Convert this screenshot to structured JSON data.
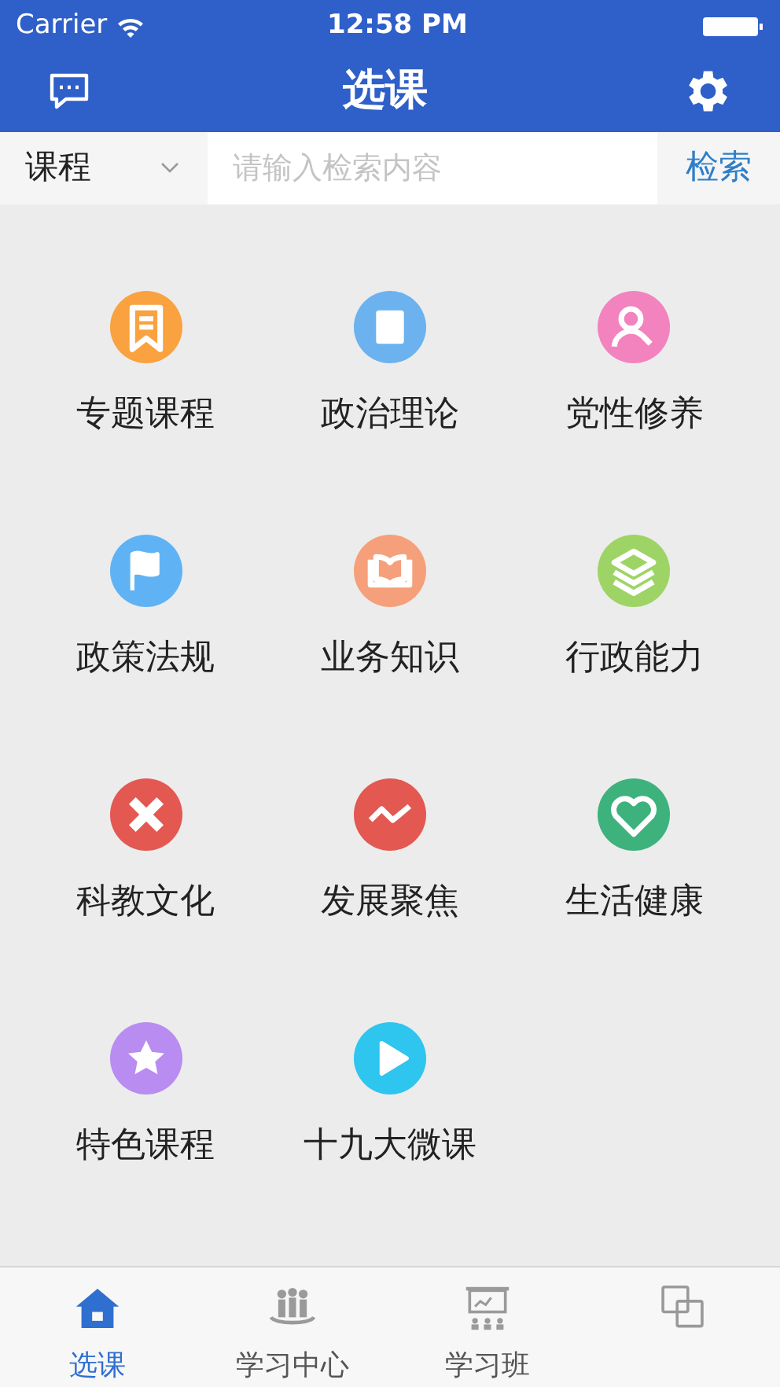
{
  "status_bar": {
    "carrier": "Carrier",
    "time": "12:58 PM"
  },
  "nav": {
    "title": "选课"
  },
  "search": {
    "scope": "课程",
    "placeholder": "请输入检索内容",
    "button": "检索"
  },
  "categories": [
    {
      "label": "专题课程",
      "color": "#f9a23f"
    },
    {
      "label": "政治理论",
      "color": "#6bb2ee"
    },
    {
      "label": "党性修养",
      "color": "#f283bf"
    },
    {
      "label": "政策法规",
      "color": "#5fb3f4"
    },
    {
      "label": "业务知识",
      "color": "#f5a07a"
    },
    {
      "label": "行政能力",
      "color": "#9ed466"
    },
    {
      "label": "科教文化",
      "color": "#e35850"
    },
    {
      "label": "发展聚焦",
      "color": "#e35850"
    },
    {
      "label": "生活健康",
      "color": "#3db27c"
    },
    {
      "label": "特色课程",
      "color": "#b88cf0"
    },
    {
      "label": "十九大微课",
      "color": "#2ec5ee"
    }
  ],
  "tabs": [
    {
      "label": "选课",
      "selected": true
    },
    {
      "label": "学习中心",
      "selected": false
    },
    {
      "label": "学习班",
      "selected": false
    },
    {
      "selected": false
    }
  ]
}
